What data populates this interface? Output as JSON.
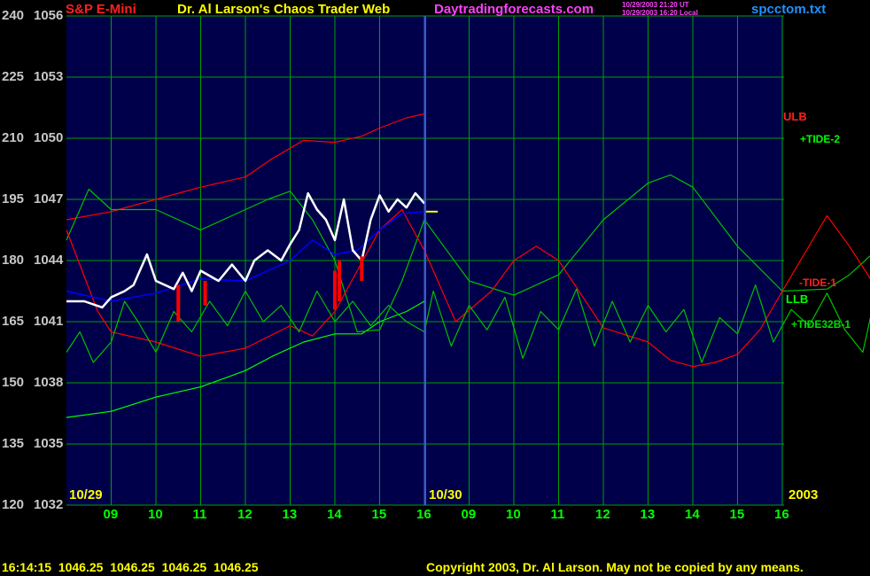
{
  "header": {
    "symbol": "S&P E-Mini",
    "title": "Dr. Al Larson's Chaos Trader Web",
    "site": "Daytradingforecasts.com",
    "timestamp_ut": "10/29/2003 21:20 UT",
    "timestamp_local": "10/29/2003 16:20 Local",
    "file": "spcctom.txt"
  },
  "footer": {
    "quote": "16:14:15  1046.25  1046.25  1046.25  1046.25",
    "copyright": "Copyright 2003, Dr. Al Larson. May not be copied by any means."
  },
  "colors": {
    "background": "#000000",
    "plot": "#00004a",
    "grid": "#00a000",
    "axis_text": "#c8c8c8",
    "date_text": "#ffff00",
    "red": "#ff0000",
    "bright_green": "#00ff00",
    "green": "#00c000",
    "price": "#ffffff",
    "wave": "#0000ff",
    "magenta": "#ff00ff",
    "cyan": "#00a0ff"
  },
  "chart_data": {
    "type": "line",
    "title": "S&P E-Mini",
    "y_labels": [
      {
        "index": "240",
        "price": "1056"
      },
      {
        "index": "225",
        "price": "1053"
      },
      {
        "index": "210",
        "price": "1050"
      },
      {
        "index": "195",
        "price": "1047"
      },
      {
        "index": "180",
        "price": "1044"
      },
      {
        "index": "165",
        "price": "1041"
      },
      {
        "index": "150",
        "price": "1038"
      },
      {
        "index": "135",
        "price": "1035"
      },
      {
        "index": "120",
        "price": "1032"
      }
    ],
    "ylim": [
      1032,
      1056
    ],
    "x_ticks": [
      "09",
      "10",
      "11",
      "12",
      "13",
      "14",
      "15",
      "16",
      "09",
      "10",
      "11",
      "12",
      "13",
      "14",
      "15",
      "16"
    ],
    "date_labels": [
      "10/29",
      "10/30"
    ],
    "year_label": "2003",
    "legend": [
      "ULB",
      "+TIDE-2",
      "-TIDE-1",
      "LLB",
      "+TIDE32B-1"
    ],
    "series": [
      {
        "name": "ULB",
        "color": "#ff0000",
        "x": [
          8.0,
          9.0,
          10.0,
          11.0,
          12.0,
          12.6,
          13.3,
          14.0,
          14.6,
          15.0,
          15.6,
          16.0
        ],
        "y": [
          1046.0,
          1046.4,
          1047.0,
          1047.6,
          1048.1,
          1049.0,
          1049.9,
          1049.8,
          1050.1,
          1050.5,
          1051.0,
          1051.2
        ]
      },
      {
        "name": "LLB",
        "color": "#00ff00",
        "x": [
          8.0,
          9.0,
          10.0,
          11.0,
          12.0,
          12.6,
          13.3,
          14.0,
          14.6,
          15.0,
          15.6,
          16.0
        ],
        "y": [
          1036.3,
          1036.6,
          1037.3,
          1037.8,
          1038.6,
          1039.3,
          1040.0,
          1040.4,
          1040.4,
          1041.0,
          1041.5,
          1042.0
        ]
      },
      {
        "name": "+TIDE-2",
        "color": "#00c000",
        "x": [
          8.0,
          8.5,
          9.0,
          10.0,
          11.0,
          12.0,
          12.5,
          13.0,
          13.5,
          14.0,
          14.5,
          15.0,
          15.5,
          16.0,
          17.0,
          18.0,
          19.0,
          20.0,
          21.0,
          21.5,
          22.0,
          23.0,
          24.0,
          25.0,
          25.5,
          26.0
        ],
        "y": [
          1045,
          1047.5,
          1046.5,
          1046.5,
          1045.5,
          1046.5,
          1047.0,
          1047.4,
          1046.0,
          1044.0,
          1040.5,
          1040.6,
          1043.0,
          1046.0,
          1043.0,
          1042.3,
          1043.3,
          1046.0,
          1047.8,
          1048.2,
          1047.6,
          1044.7,
          1042.5,
          1042.6,
          1043.3,
          1044.3
        ]
      },
      {
        "name": "-TIDE-1",
        "color": "#ff0000",
        "x": [
          8.0,
          8.7,
          9.0,
          10.0,
          11.0,
          12.0,
          13.0,
          13.5,
          14.0,
          14.5,
          15.0,
          15.5,
          16.0,
          16.7,
          17.5,
          18.0,
          18.5,
          19.0,
          20.0,
          21.0,
          21.5,
          22.0,
          22.5,
          23.0,
          23.5,
          24.0,
          25.0,
          25.5,
          26.0
        ],
        "y": [
          1045.5,
          1041.5,
          1040.5,
          1040.0,
          1039.3,
          1039.7,
          1040.8,
          1040.3,
          1041.5,
          1043.5,
          1045.5,
          1046.5,
          1044.5,
          1041.0,
          1042.5,
          1044.0,
          1044.7,
          1044.0,
          1040.7,
          1040.0,
          1039.1,
          1038.8,
          1039.0,
          1039.4,
          1040.6,
          1042.5,
          1046.2,
          1044.7,
          1043.0
        ]
      },
      {
        "name": "+TIDE32B-1",
        "color": "#00c000",
        "x": [
          8.0,
          8.3,
          8.6,
          9.0,
          9.3,
          9.6,
          10.0,
          10.4,
          10.8,
          11.2,
          11.6,
          12.0,
          12.4,
          12.8,
          13.2,
          13.6,
          14.0,
          14.4,
          14.8,
          15.2,
          15.6,
          16.0,
          16.2,
          16.6,
          17.0,
          17.4,
          17.8,
          18.2,
          18.6,
          19.0,
          19.4,
          19.8,
          20.2,
          20.6,
          21.0,
          21.4,
          21.8,
          22.2,
          22.6,
          23.0,
          23.4,
          23.8,
          24.2,
          24.6,
          25.0,
          25.4,
          25.8,
          26.0
        ],
        "y": [
          1039.5,
          1040.5,
          1039.0,
          1040.0,
          1042.0,
          1041.0,
          1039.5,
          1041.5,
          1040.5,
          1042.0,
          1040.8,
          1042.5,
          1041.0,
          1041.8,
          1040.5,
          1042.5,
          1041.0,
          1042.0,
          1040.8,
          1041.8,
          1041.0,
          1040.5,
          1042.5,
          1039.8,
          1041.8,
          1040.6,
          1042.2,
          1039.2,
          1041.5,
          1040.6,
          1042.6,
          1039.8,
          1042.0,
          1040.0,
          1041.8,
          1040.5,
          1041.6,
          1039.0,
          1041.2,
          1040.4,
          1042.8,
          1040.0,
          1041.6,
          1040.8,
          1042.4,
          1040.6,
          1039.5,
          1041.5
        ]
      },
      {
        "name": "Wave",
        "color": "#0000ff",
        "x": [
          8.0,
          9.0,
          10.0,
          11.0,
          12.0,
          13.0,
          13.5,
          14.0,
          14.5,
          15.0,
          15.5,
          16.0
        ],
        "y": [
          1042.5,
          1042.0,
          1042.4,
          1043.1,
          1043.0,
          1044.0,
          1045.0,
          1044.3,
          1044.5,
          1045.5,
          1046.3,
          1046.4
        ]
      },
      {
        "name": "Price",
        "color": "#ffffff",
        "x": [
          8.0,
          8.4,
          8.8,
          9.0,
          9.3,
          9.5,
          9.8,
          10.0,
          10.4,
          10.6,
          10.8,
          11.0,
          11.4,
          11.7,
          12.0,
          12.2,
          12.5,
          12.8,
          13.0,
          13.2,
          13.4,
          13.6,
          13.8,
          14.0,
          14.2,
          14.4,
          14.6,
          14.8,
          15.0,
          15.2,
          15.4,
          15.6,
          15.8,
          16.0
        ],
        "y": [
          1042.0,
          1042.0,
          1041.7,
          1042.2,
          1042.5,
          1042.8,
          1044.3,
          1043.0,
          1042.6,
          1043.4,
          1042.5,
          1043.5,
          1043.0,
          1043.8,
          1043.0,
          1044.0,
          1044.5,
          1044.0,
          1044.8,
          1045.5,
          1047.3,
          1046.5,
          1046.0,
          1045.0,
          1047.0,
          1044.5,
          1044.0,
          1046.0,
          1047.2,
          1046.4,
          1047.0,
          1046.6,
          1047.3,
          1046.8
        ]
      }
    ],
    "red_bars": [
      {
        "x": 10.5,
        "low": 1041.0,
        "high": 1042.8
      },
      {
        "x": 11.1,
        "low": 1041.8,
        "high": 1043.0
      },
      {
        "x": 14.0,
        "low": 1041.6,
        "high": 1043.5
      },
      {
        "x": 14.1,
        "low": 1042.0,
        "high": 1044.0
      },
      {
        "x": 14.6,
        "low": 1043.0,
        "high": 1044.2
      }
    ],
    "close_marker": {
      "x": [
        16.0,
        16.3
      ],
      "y": 1046.4
    }
  }
}
